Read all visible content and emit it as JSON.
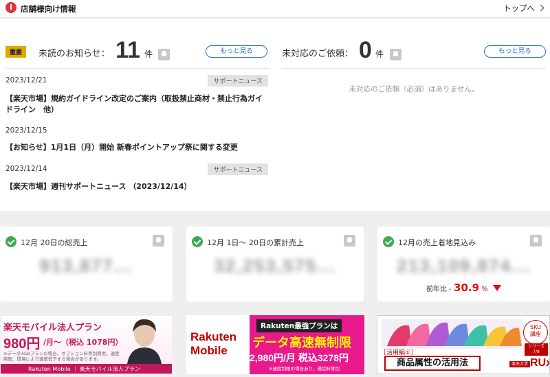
{
  "header": {
    "title": "店舗様向け情報",
    "top_link": "トップへ"
  },
  "notices": {
    "important_badge": "重要",
    "unread_label": "未読のお知らせ：",
    "unread_count": "11",
    "unit": "件",
    "more_label": "もっと見る",
    "items": [
      {
        "date": "2023/12/21",
        "tag": "サポートニュース",
        "title": "【楽天市場】規約ガイドライン改定のご案内（取扱禁止商材・禁止行為ガイドライン　他）"
      },
      {
        "date": "2023/12/15",
        "tag": "",
        "title": "【お知らせ】1月1日（月）開始 新春ポイントアップ祭に関する変更"
      },
      {
        "date": "2023/12/14",
        "tag": "サポートニュース",
        "title": "【楽天市場】週刊サポートニュース （2023/12/14）"
      }
    ]
  },
  "requests": {
    "label": "未対応のご依頼：",
    "count": "0",
    "unit": "件",
    "more_label": "もっと見る",
    "empty_message": "未対応のご依頼（必須）はありません。"
  },
  "sales": {
    "cards": [
      {
        "title": "12月 20日の総売上",
        "amount": "913,877..."
      },
      {
        "title": "12月 1日〜 20日の累計売上",
        "amount": "32,253,575..."
      },
      {
        "title": "12月の売上着地見込み",
        "amount": "213,109,874..."
      }
    ],
    "yoy_label": "前年比 -",
    "yoy_value": "30.9",
    "yoy_unit": "%"
  },
  "banners": {
    "mobile_plan": {
      "title": "楽天モバイル法人プラン",
      "price": "980円",
      "price_sub": "/月〜（税込 1078円）",
      "note": "※データ3GBプランの場合。オプション料等別費用。速度制限、環境により速度低下する場合があります。",
      "footer": "Rakuten Mobile ｜ 楽天モバイル法人プラン"
    },
    "saikyo_plan": {
      "logo_line1": "Rakuten",
      "logo_line2": "Mobile",
      "headline": "Rakuten最強プランは",
      "main": "データ高速無制限",
      "price": "2,980円/月 税込3278円",
      "note": "※速度制限の場合あり。通話料等別"
    },
    "rux": {
      "subtitle": "［活用編①］",
      "title": "商品属性の活用法",
      "sku_line1": "SKU",
      "sku_line2": "講座",
      "series": "シリーズ 7/8",
      "badge": "楽天大学",
      "logo": "RUx"
    }
  },
  "colors": {
    "accent_red": "#d11111",
    "link_blue": "#1e6fcf",
    "check_green": "#3dab52",
    "badge_yellow": "#e0a800"
  }
}
